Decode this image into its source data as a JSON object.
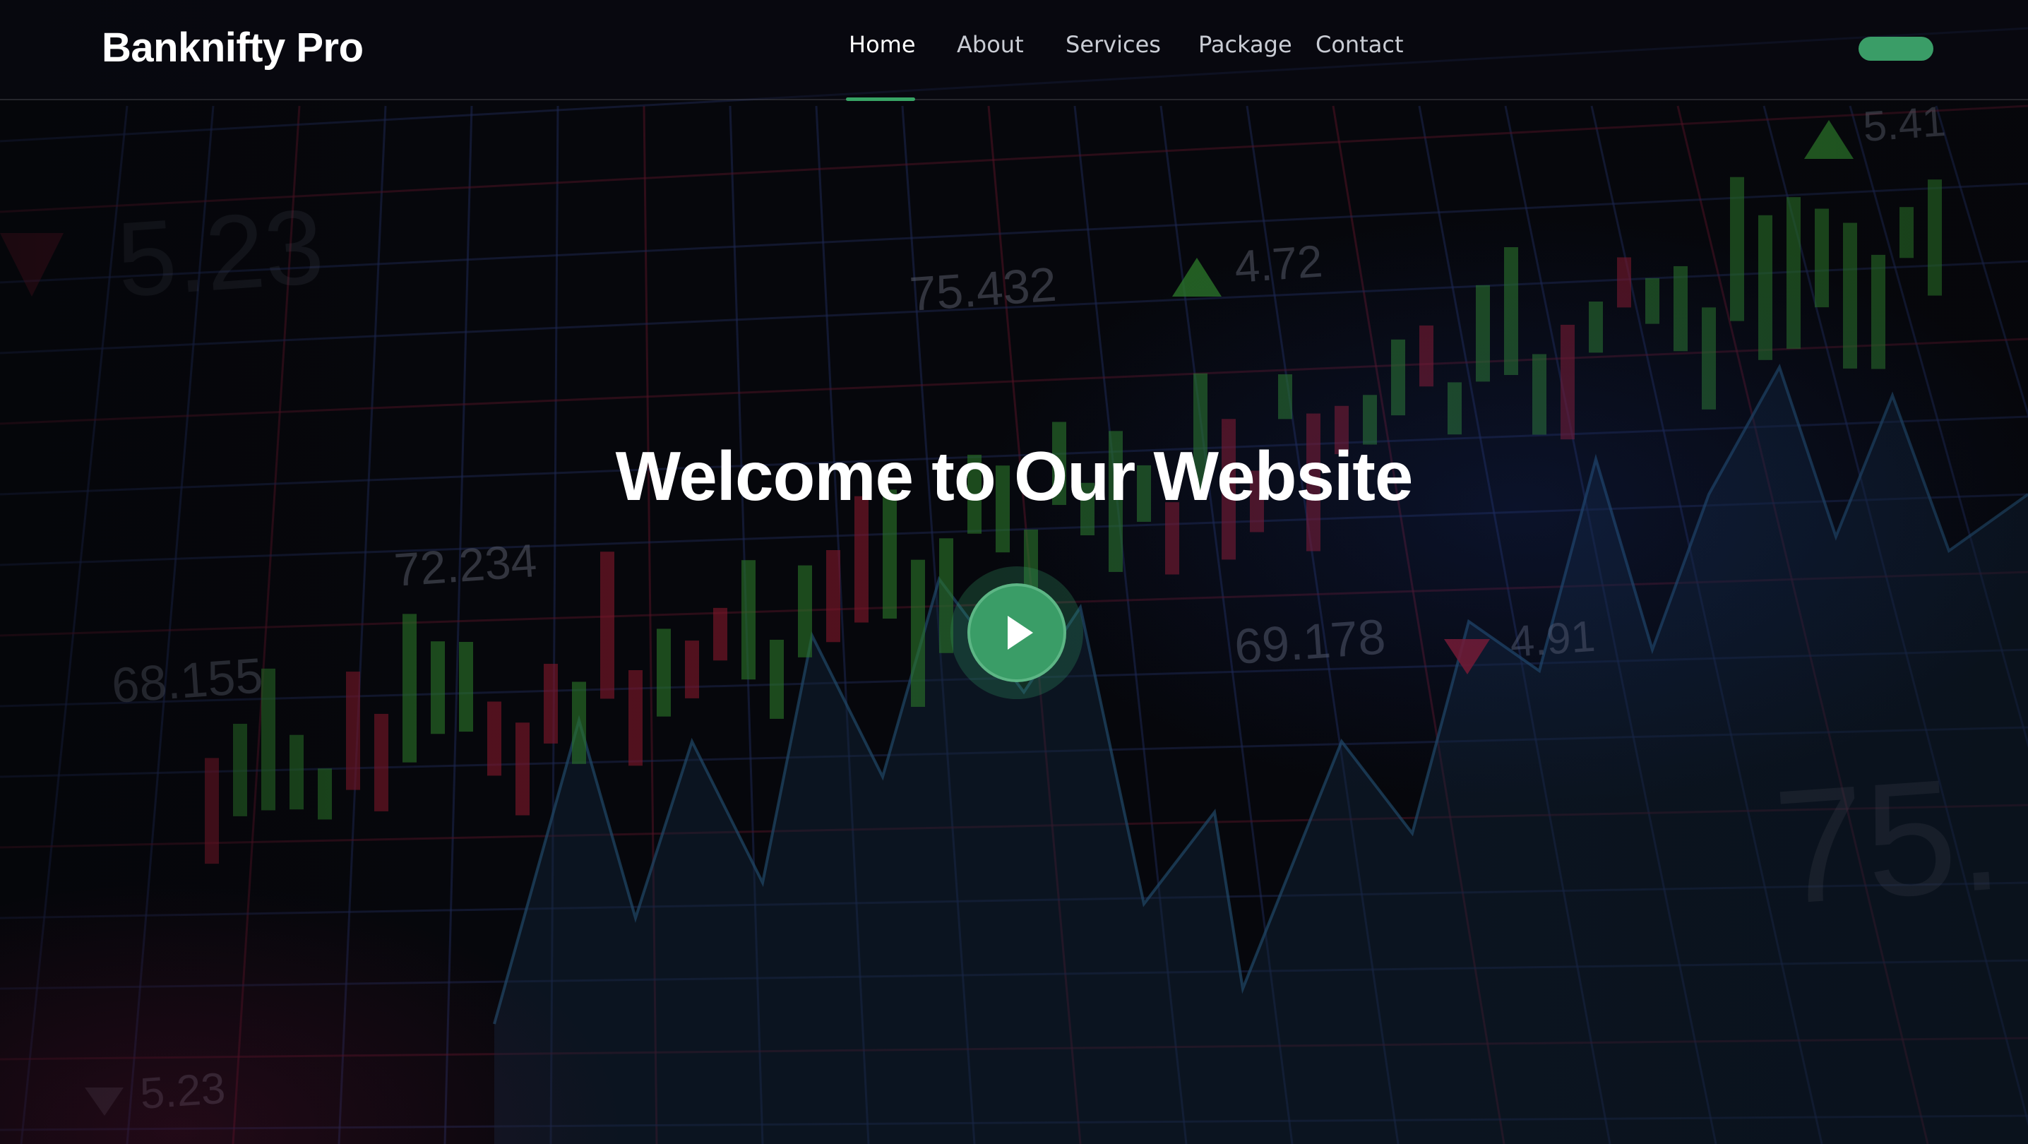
{
  "header": {
    "brand": "Banknifty Pro",
    "nav": [
      {
        "label": "Home",
        "active": true
      },
      {
        "label": "About",
        "active": false
      },
      {
        "label": "Services",
        "active": false
      },
      {
        "label": "Package",
        "active": false
      },
      {
        "label": "Contact",
        "active": false
      }
    ],
    "cta_label": ""
  },
  "hero": {
    "title": "Welcome to Our Website",
    "play_icon": "play-icon",
    "background_numbers": [
      "75.432",
      "4.72",
      "5.41",
      "5.23",
      "72.234",
      "68.155",
      "69.178",
      "4.91",
      "5.23",
      "75."
    ]
  },
  "colors": {
    "accent": "#3a9d67",
    "candle_up": "#3fae3a",
    "candle_down": "#c2203c",
    "background": "#07080d",
    "grid_blue": "#2b3a78",
    "grid_red": "#7a1a33"
  }
}
